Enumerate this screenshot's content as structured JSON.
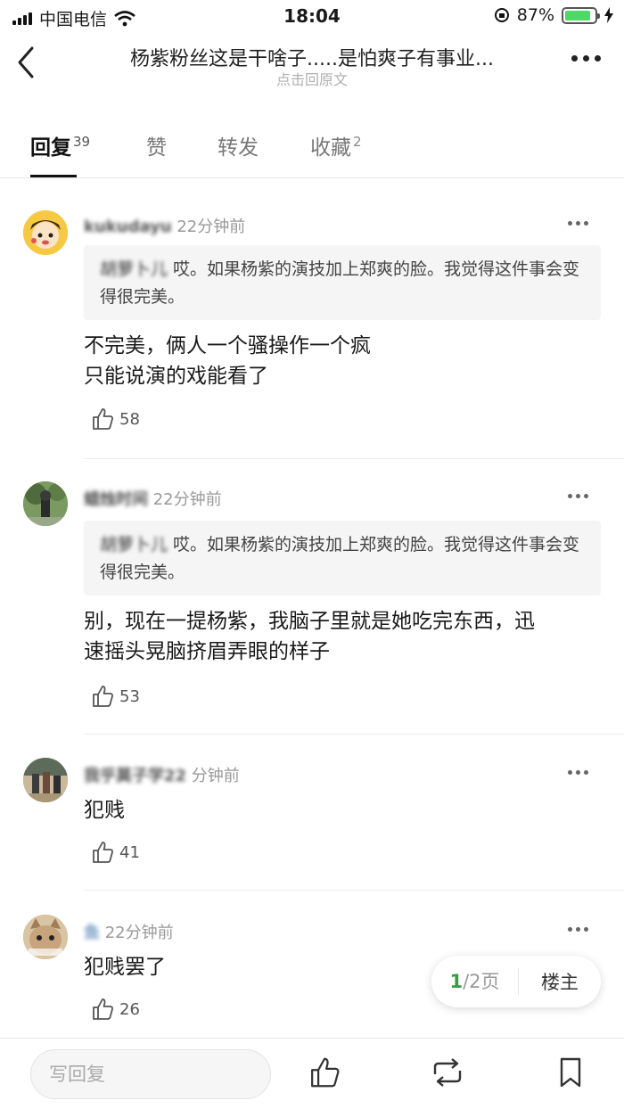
{
  "status_bar": {
    "carrier": "中国电信",
    "time": "18:04",
    "battery_percent": "87%",
    "battery_level": 0.87
  },
  "nav": {
    "title": "杨紫粉丝这是干啥子.....是怕爽子有事业...",
    "subtitle": "点击回原文"
  },
  "tabs": [
    {
      "label": "回复",
      "count": "39"
    },
    {
      "label": "赞",
      "count": ""
    },
    {
      "label": "转发",
      "count": ""
    },
    {
      "label": "收藏",
      "count": "2"
    }
  ],
  "comments": [
    {
      "username": "kukudayu",
      "time": "22分钟前",
      "quote_name": "胡萝卜儿",
      "quote_text": "哎。如果杨紫的演技加上郑爽的脸。我觉得这件事会变得很完美。",
      "lines": [
        "不完美，俩人一个骚操作一个疯",
        "只能说演的戏能看了"
      ],
      "likes": "58"
    },
    {
      "username": "蜡烛时间",
      "time": "22分钟前",
      "quote_name": "胡萝卜儿",
      "quote_text": "哎。如果杨紫的演技加上郑爽的脸。我觉得这件事会变得很完美。",
      "lines": [
        "别，现在一提杨紫，我脑子里就是她吃完东西，迅",
        "速摇头晃脑挤眉弄眼的样子"
      ],
      "likes": "53"
    },
    {
      "username": "我乎莫子学22",
      "time": "分钟前",
      "lines": [
        "犯贱"
      ],
      "likes": "41"
    },
    {
      "username": "鱼",
      "time": "22分钟前",
      "lines": [
        "犯贱罢了"
      ],
      "likes": "26"
    }
  ],
  "pager": {
    "current": "1",
    "total": "/2页",
    "op_label": "楼主"
  },
  "bottom_bar": {
    "reply_placeholder": "写回复"
  },
  "colors": {
    "accent_green": "#3a9b45",
    "battery_green": "#4cd964"
  }
}
